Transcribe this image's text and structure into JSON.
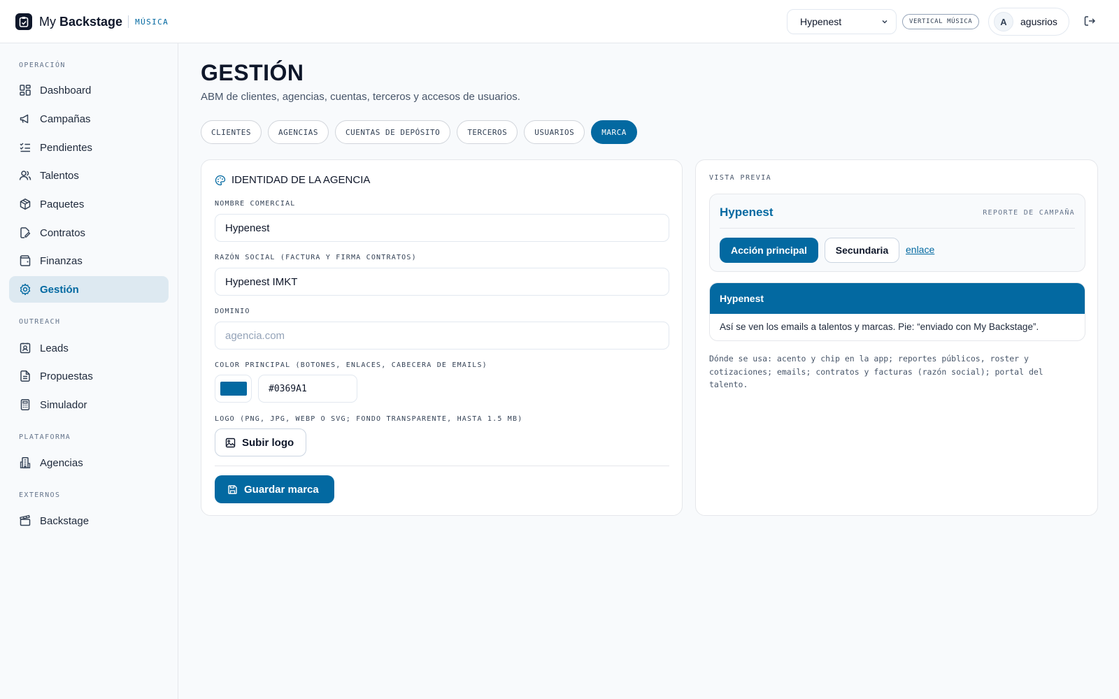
{
  "app": {
    "brand_prefix": "My ",
    "brand_strong": "Backstage",
    "brand_tag": "MÚSICA",
    "agency_selected": "Hypenest",
    "vertical_chip": "VERTICAL MÚSICA",
    "user_initial": "A",
    "user_name": "agusrios"
  },
  "sidebar": {
    "sections": {
      "operacion": "OPERACIÓN",
      "outreach": "OUTREACH",
      "plataforma": "PLATAFORMA",
      "externos": "EXTERNOS"
    },
    "items": {
      "dashboard": "Dashboard",
      "campanas": "Campañas",
      "pendientes": "Pendientes",
      "talentos": "Talentos",
      "paquetes": "Paquetes",
      "contratos": "Contratos",
      "finanzas": "Finanzas",
      "gestion": "Gestión",
      "leads": "Leads",
      "propuestas": "Propuestas",
      "simulador": "Simulador",
      "agencias": "Agencias",
      "backstage": "Backstage"
    }
  },
  "page": {
    "title": "GESTIÓN",
    "subtitle": "ABM de clientes, agencias, cuentas, terceros y accesos de usuarios."
  },
  "tabs": {
    "clientes": "CLIENTES",
    "agencias": "AGENCIAS",
    "cuentas": "CUENTAS DE DEPÓSITO",
    "terceros": "TERCEROS",
    "usuarios": "USUARIOS",
    "marca": "MARCA"
  },
  "form": {
    "title": "IDENTIDAD DE LA AGENCIA",
    "nombre_label": "NOMBRE COMERCIAL",
    "nombre_value": "Hypenest",
    "razon_label": "RAZÓN SOCIAL (FACTURA Y FIRMA CONTRATOS)",
    "razon_value": "Hypenest IMKT",
    "dominio_label": "DOMINIO",
    "dominio_placeholder": "agencia.com",
    "color_label": "COLOR PRINCIPAL (BOTONES, ENLACES, CABECERA DE EMAILS)",
    "color_value": "#0369A1",
    "logo_label": "LOGO (PNG, JPG, WEBP O SVG; FONDO TRANSPARENTE, HASTA 1.5 MB)",
    "upload_label": "Subir logo",
    "save_label": "Guardar marca"
  },
  "preview": {
    "label": "VISTA PREVIA",
    "brand": "Hypenest",
    "report_tag": "REPORTE DE CAMPAÑA",
    "primary_btn": "Acción principal",
    "secondary_btn": "Secundaria",
    "link": "enlace",
    "email_header": "Hypenest",
    "email_body": "Así se ven los emails a talentos y marcas. Pie: “enviado con My Backstage”.",
    "usage_note": "Dónde se usa: acento y chip en la app; reportes públicos, roster y cotizaciones; emails; contratos y facturas (razón social); portal del talento."
  },
  "colors": {
    "accent": "#0369A1",
    "active_nav_bg": "#dde9f1",
    "text": "#0f172a",
    "border": "#e5e7eb"
  },
  "icons": {
    "brand": "clipboard-icon",
    "logout": "logout-icon"
  }
}
